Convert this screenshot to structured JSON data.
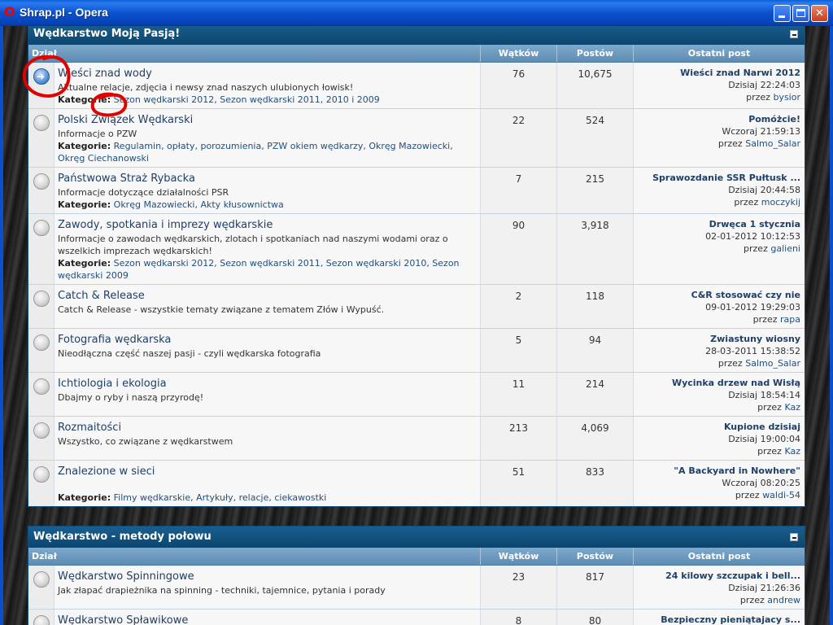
{
  "window": {
    "title": "Shrap.pl - Opera"
  },
  "columns": {
    "dzial": "Dział",
    "watkow": "Wątków",
    "postow": "Postów",
    "ostatni": "Ostatni post"
  },
  "cat1": {
    "title": "Wędkarstwo Moją Pasją!",
    "rows": [
      {
        "title": "Wieści znad wody",
        "desc": "Aktualne relacje, zdjęcia i newsy znad naszych ulubionych łowisk!",
        "kat_label": "Kategorie:",
        "kat": "Sezon wędkarski 2012, Sezon wędkarski 2011, 2010 i 2009",
        "watkow": "76",
        "postow": "10,675",
        "last_title": "Wieści znad Narwi 2012",
        "last_date": "Dzisiaj 22:24:03",
        "by_label": "przez",
        "last_user": "bysior"
      },
      {
        "title": "Polski Związek Wędkarski",
        "desc": "Informacje o PZW",
        "kat_label": "Kategorie:",
        "kat": "Regulamin, opłaty, porozumienia, PZW okiem wędkarzy, Okręg Mazowiecki, Okręg Ciechanowski",
        "watkow": "22",
        "postow": "524",
        "last_title": "Pomóżcie!",
        "last_date": "Wczoraj 21:59:13",
        "by_label": "przez",
        "last_user": "Salmo_Salar"
      },
      {
        "title": "Państwowa Straż Rybacka",
        "desc": "Informacje dotyczące działalności PSR",
        "kat_label": "Kategorie:",
        "kat": "Okręg Mazowiecki, Akty kłusownictwa",
        "watkow": "7",
        "postow": "215",
        "last_title": "Sprawozdanie SSR Pułtusk ...",
        "last_date": "Dzisiaj 20:44:58",
        "by_label": "przez",
        "last_user": "moczykij"
      },
      {
        "title": "Zawody, spotkania i imprezy wędkarskie",
        "desc": "Informacje o zawodach wędkarskich, zlotach i spotkaniach nad naszymi wodami oraz o wszelkich imprezach wędkarskich!",
        "kat_label": "Kategorie:",
        "kat": "Sezon wędkarski 2012, Sezon wędkarski 2011, Sezon wędkarski 2010, Sezon wędkarski 2009",
        "watkow": "90",
        "postow": "3,918",
        "last_title": "Drwęca 1 stycznia",
        "last_date": "02-01-2012 10:12:53",
        "by_label": "przez",
        "last_user": "galieni"
      },
      {
        "title": "Catch & Release",
        "desc": "Catch & Release - wszystkie tematy związane z tematem Złów i Wypuść.",
        "watkow": "2",
        "postow": "118",
        "last_title": "C&R stosować czy nie",
        "last_date": "09-01-2012 19:29:03",
        "by_label": "przez",
        "last_user": "rapa"
      },
      {
        "title": "Fotografia wędkarska",
        "desc": "Nieodłączna część naszej pasji - czyli wędkarska fotografia",
        "watkow": "5",
        "postow": "94",
        "last_title": "Zwiastuny wiosny",
        "last_date": "28-03-2011 15:38:52",
        "by_label": "przez",
        "last_user": "Salmo_Salar"
      },
      {
        "title": "Ichtiologia i ekologia",
        "desc": "Dbajmy o ryby i naszą przyrodę!",
        "watkow": "11",
        "postow": "214",
        "last_title": "Wycinka drzew nad Wisłą",
        "last_date": "Dzisiaj 18:54:14",
        "by_label": "przez",
        "last_user": "Kaz"
      },
      {
        "title": "Rozmaitości",
        "desc": "Wszystko, co związane z wędkarstwem",
        "watkow": "213",
        "postow": "4,069",
        "last_title": "Kupione dzisiaj",
        "last_date": "Dzisiaj 19:00:04",
        "by_label": "przez",
        "last_user": "Kaz"
      },
      {
        "title": "Znalezione w sieci",
        "desc": "",
        "kat_label": "Kategorie:",
        "kat": "Filmy wędkarskie, Artykuły, relacje, ciekawostki",
        "watkow": "51",
        "postow": "833",
        "last_title": "\"A Backyard in Nowhere\"",
        "last_date": "Wczoraj 08:20:25",
        "by_label": "przez",
        "last_user": "waldi-54"
      }
    ]
  },
  "cat2": {
    "title": "Wędkarstwo - metody połowu",
    "rows": [
      {
        "title": "Wędkarstwo Spinningowe",
        "desc": "Jak złapać drapieżnika na spinning - techniki, tajemnice, pytania i porady",
        "watkow": "23",
        "postow": "817",
        "last_title": "24 kilowy szczupak i bell...",
        "last_date": "Dzisiaj 21:26:36",
        "by_label": "przez",
        "last_user": "andrew"
      },
      {
        "title": "Wędkarstwo Spławikowe",
        "desc": "",
        "watkow": "8",
        "postow": "80",
        "last_title": "Bezpieczny pieniątajacy s...",
        "last_date": "",
        "by_label": "",
        "last_user": ""
      }
    ]
  },
  "colors": {
    "header": "#0b466f",
    "colhead": "#5d8cb3",
    "title_link": "#1f3f66",
    "marker": "#e00000"
  }
}
